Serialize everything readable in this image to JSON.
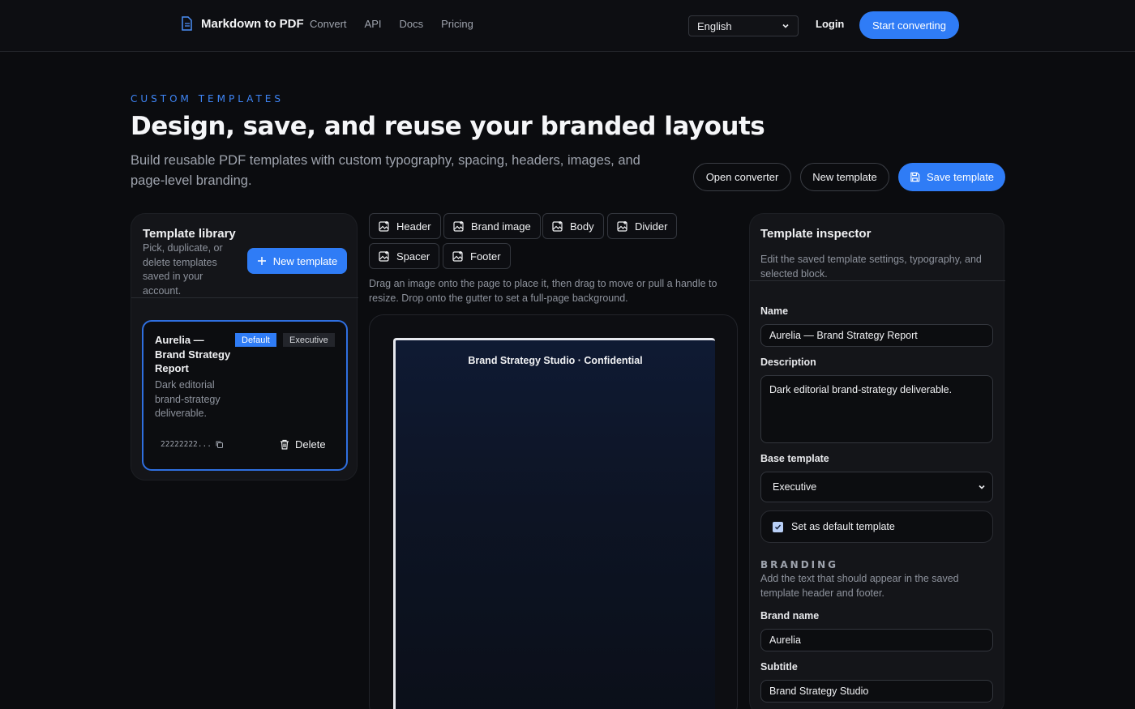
{
  "nav": {
    "brand": "Markdown to PDF",
    "links": [
      "Convert",
      "API",
      "Docs",
      "Pricing"
    ],
    "language": "English",
    "login": "Login",
    "cta": "Start converting"
  },
  "hero": {
    "eyebrow": "CUSTOM TEMPLATES",
    "title": "Design, save, and reuse your branded layouts",
    "subtitle": "Build reusable PDF templates with custom typography, spacing, headers, images, and page-level branding.",
    "actions": {
      "open_converter": "Open converter",
      "new_template": "New template",
      "save_template": "Save template"
    }
  },
  "library": {
    "title": "Template library",
    "description": "Pick, duplicate, or delete templates saved in your account.",
    "new_button": "New template",
    "card": {
      "name": "Aurelia — Brand Strategy Report",
      "description": "Dark editorial brand-strategy deliverable.",
      "badge_default": "Default",
      "badge_base": "Executive",
      "id": "22222222...",
      "delete": "Delete"
    }
  },
  "blocks": {
    "items": [
      "Header",
      "Brand image",
      "Body",
      "Divider",
      "Spacer",
      "Footer"
    ],
    "hint": "Drag an image onto the page to place it, then drag to move or pull a handle to resize. Drop onto the gutter to set a full-page background."
  },
  "canvas": {
    "header_text": "Brand Strategy Studio · Confidential"
  },
  "inspector": {
    "title": "Template inspector",
    "description": "Edit the saved template settings, typography, and selected block.",
    "name_label": "Name",
    "name_value": "Aurelia — Brand Strategy Report",
    "description_label": "Description",
    "description_value": "Dark editorial brand-strategy deliverable.",
    "base_label": "Base template",
    "base_value": "Executive",
    "default_label": "Set as default template",
    "default_checked": true,
    "branding_eyebrow": "BRANDING",
    "branding_desc": "Add the text that should appear in the saved template header and footer.",
    "brand_name_label": "Brand name",
    "brand_name_value": "Aurelia",
    "subtitle_label": "Subtitle",
    "subtitle_value": "Brand Strategy Studio"
  },
  "colors": {
    "accent": "#2f7cf6",
    "background": "#0b0c0f",
    "panel": "#141519"
  }
}
